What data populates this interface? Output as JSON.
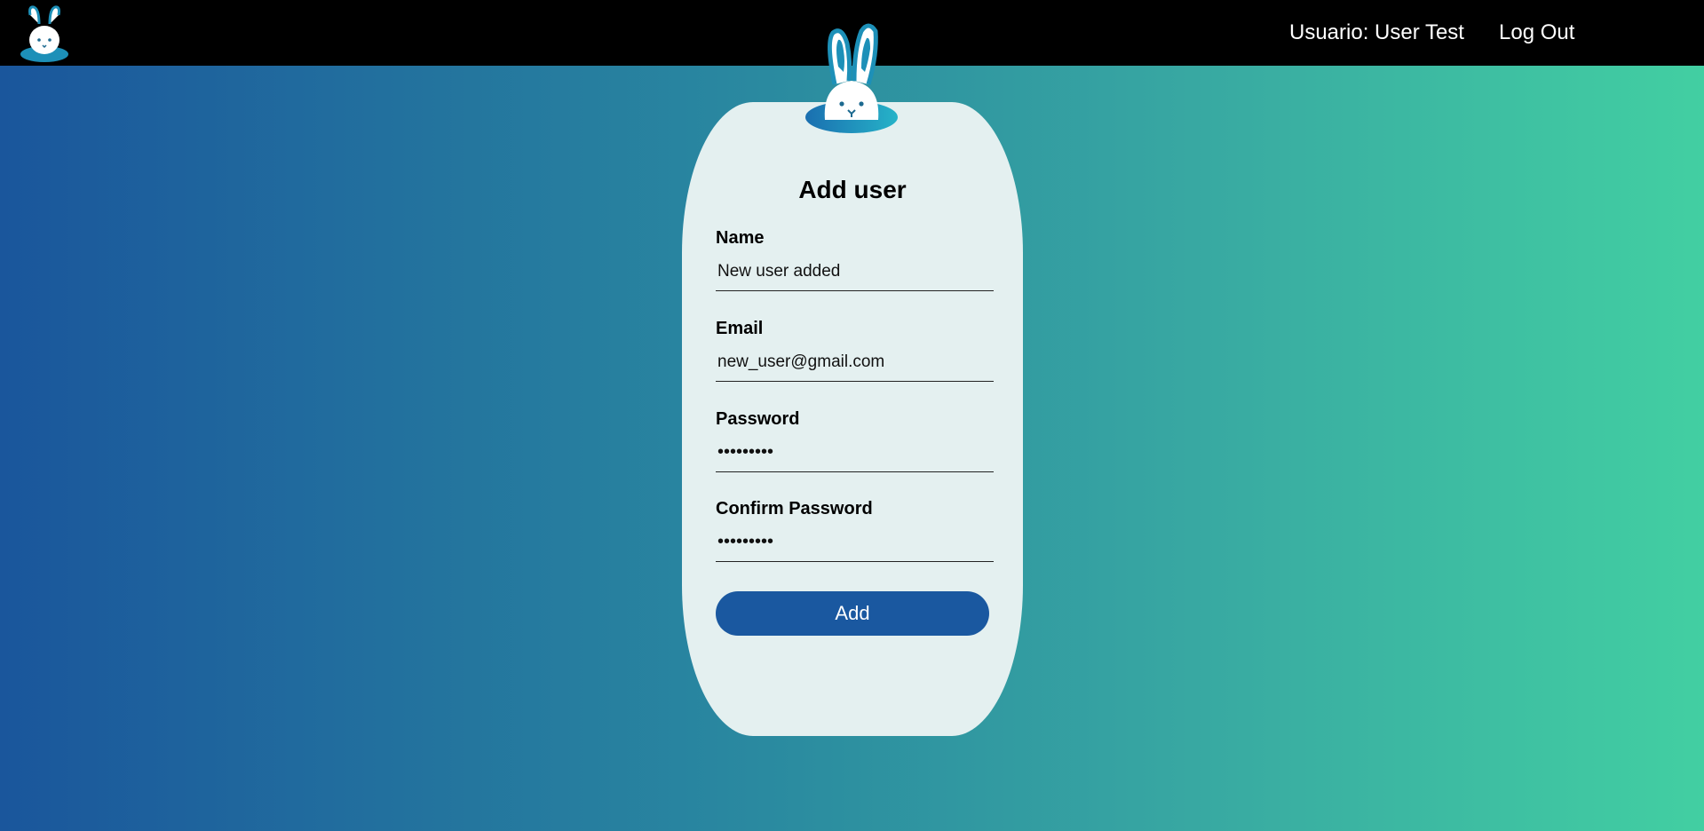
{
  "header": {
    "user_label": "Usuario: User Test",
    "logout_label": "Log Out"
  },
  "form": {
    "title": "Add user",
    "name_label": "Name",
    "name_value": "New user added",
    "email_label": "Email",
    "email_value": "new_user@gmail.com",
    "password_label": "Password",
    "password_value": "•••••••••",
    "confirm_label": "Confirm Password",
    "confirm_value": "•••••••••",
    "submit_label": "Add"
  },
  "colors": {
    "topbar": "#000000",
    "card": "#e4f0f0",
    "button": "#1a58a0",
    "gradient_start": "#1a569c",
    "gradient_end": "#42cfa2"
  },
  "icons": {
    "small_logo": "bunny-logo-icon",
    "card_logo": "bunny-logo-icon"
  }
}
